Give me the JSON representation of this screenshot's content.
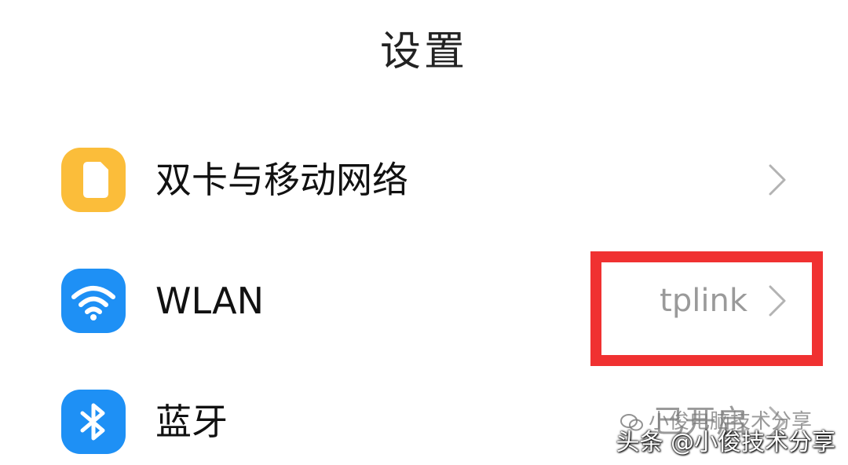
{
  "page": {
    "title": "设置"
  },
  "rows": [
    {
      "label": "双卡与移动网络",
      "value": "",
      "icon": "sim-card-icon",
      "icon_color": "#fbbd3a"
    },
    {
      "label": "WLAN",
      "value": "tplink",
      "icon": "wifi-icon",
      "icon_color": "#1e90f5"
    },
    {
      "label": "蓝牙",
      "value": "已开启",
      "icon": "bluetooth-icon",
      "icon_color": "#1e90f5"
    }
  ],
  "annotation": {
    "highlight_color": "#f03131"
  },
  "watermark": {
    "top_text": "小俊电脑技术分享",
    "bottom_text": "头条 @小俊技术分享"
  }
}
